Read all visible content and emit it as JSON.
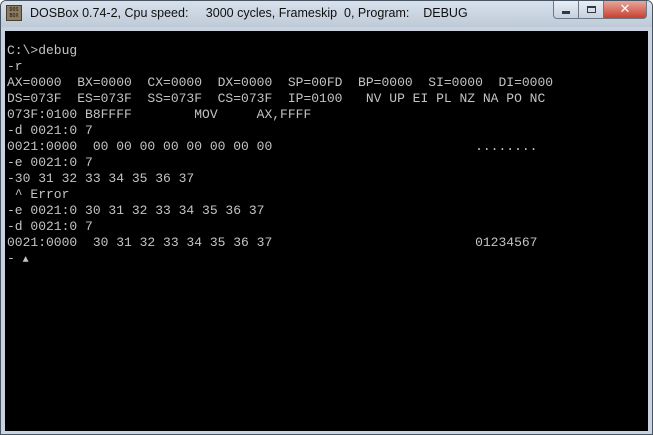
{
  "window": {
    "icon_text": "DOS\nBOX",
    "title": "DOSBox 0.74-2, Cpu speed:     3000 cycles, Frameskip  0, Program:    DEBUG",
    "controls": {
      "minimize": "minimize",
      "maximize": "maximize",
      "close": "✕"
    }
  },
  "console": {
    "lines": [
      "C:\\>debug",
      "-r",
      "AX=0000  BX=0000  CX=0000  DX=0000  SP=00FD  BP=0000  SI=0000  DI=0000",
      "DS=073F  ES=073F  SS=073F  CS=073F  IP=0100   NV UP EI PL NZ NA PO NC",
      "073F:0100 B8FFFF        MOV     AX,FFFF",
      "-d 0021:0 7",
      "0021:0000  00 00 00 00 00 00 00 00                          ........",
      "-e 0021:0 7",
      "-30 31 32 33 34 35 36 37",
      " ^ Error",
      "-e 0021:0 30 31 32 33 34 35 36 37",
      "-d 0021:0 7",
      "0021:0000  30 31 32 33 34 35 36 37                          01234567",
      "-"
    ],
    "cursor": "▲"
  }
}
